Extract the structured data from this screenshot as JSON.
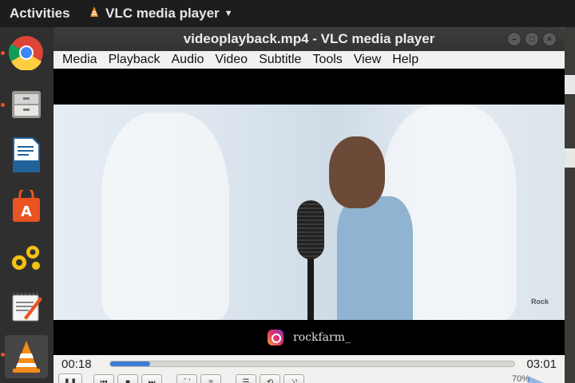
{
  "topbar": {
    "activities": "Activities",
    "app_name": "VLC media player",
    "accent": "#e95420"
  },
  "dock": {
    "items": [
      {
        "name": "chrome-icon",
        "running": true
      },
      {
        "name": "files-icon",
        "running": true
      },
      {
        "name": "writer-icon",
        "running": false
      },
      {
        "name": "software-icon",
        "running": false
      },
      {
        "name": "settings-gears-icon",
        "running": false
      },
      {
        "name": "text-editor-icon",
        "running": false
      },
      {
        "name": "vlc-icon",
        "running": true,
        "active": true
      }
    ]
  },
  "window": {
    "title": "videoplayback.mp4 - VLC media player",
    "buttons": [
      "minimize",
      "maximize",
      "close"
    ],
    "menu": [
      "Media",
      "Playback",
      "Audio",
      "Video",
      "Subtitle",
      "Tools",
      "View",
      "Help"
    ]
  },
  "video": {
    "caption": "rockfarm_",
    "watermark": "Rock"
  },
  "playback": {
    "elapsed": "00:18",
    "duration": "03:01",
    "progress": 0.1,
    "volume": "70%",
    "seek_color": "#3d7fd6"
  }
}
